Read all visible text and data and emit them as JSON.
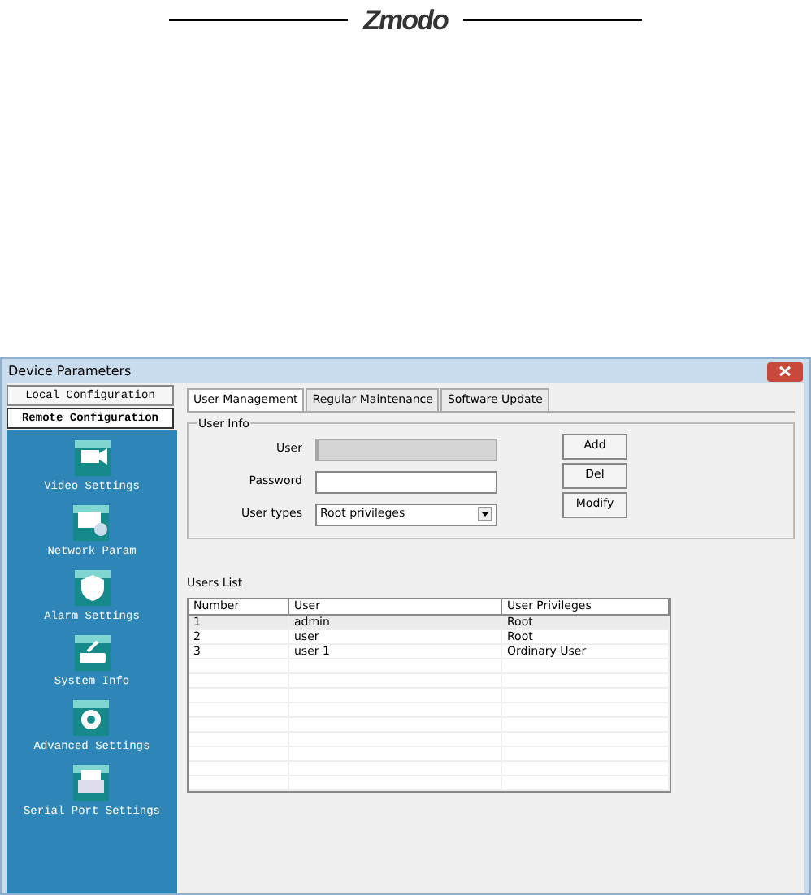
{
  "logo": {
    "text": "Zmodo"
  },
  "window": {
    "title": "Device Parameters"
  },
  "config_buttons": [
    {
      "label": "Local Configuration",
      "selected": false
    },
    {
      "label": "Remote Configuration",
      "selected": true
    }
  ],
  "nav_items": [
    {
      "label": "Video Settings"
    },
    {
      "label": "Network Param"
    },
    {
      "label": "Alarm Settings"
    },
    {
      "label": "System Info"
    },
    {
      "label": "Advanced Settings"
    },
    {
      "label": "Serial Port Settings"
    }
  ],
  "tabs": [
    {
      "label": "User Management",
      "selected": true
    },
    {
      "label": "Regular Maintenance",
      "selected": false
    },
    {
      "label": "Software Update",
      "selected": false
    }
  ],
  "user_info": {
    "title": "User Info",
    "fields": [
      {
        "label": "User",
        "kind": "text",
        "disabled": true
      },
      {
        "label": "Password",
        "kind": "text",
        "disabled": false
      },
      {
        "label": "User types",
        "kind": "select",
        "value": "Root privileges",
        "disabled": false
      }
    ]
  },
  "buttons": [
    "Add",
    "Del",
    "Modify"
  ],
  "users_list": {
    "title": "Users List",
    "columns": [
      "Number",
      "User",
      "User Privileges"
    ],
    "rows": [
      {
        "cells": [
          "1",
          "admin",
          "Root"
        ],
        "selected": true
      },
      {
        "cells": [
          "2",
          "user",
          "Root"
        ],
        "selected": false
      },
      {
        "cells": [
          "3",
          "user 1",
          "Ordinary User"
        ],
        "selected": false
      }
    ]
  }
}
